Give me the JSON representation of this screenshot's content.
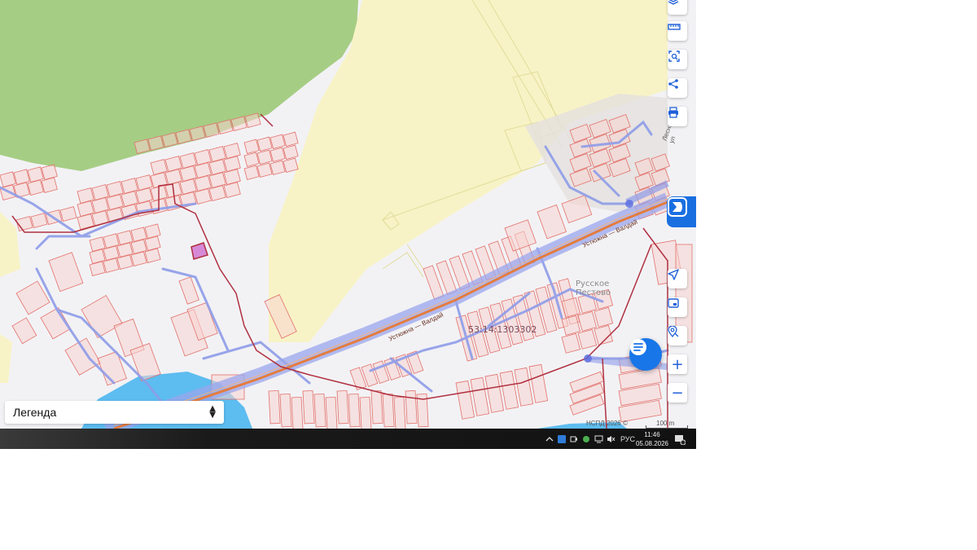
{
  "map": {
    "cadastral_number": "53:14:1303302",
    "locality": "Русское\nПестово",
    "locality_line1": "Русское",
    "locality_line2": "Пестово",
    "road_labels": [
      "Устюжна — Валдай",
      "Устюжна — Валдай",
      "Лесная ул"
    ],
    "attribution": "НСПД 2026 ©",
    "scale": "100 m",
    "colors": {
      "forest": "#a6cd84",
      "farmland": "#f8f3c6",
      "parcel_fill": "#f7d3d0",
      "parcel_stroke": "#e3716b",
      "road_blue": "#8e9ce8",
      "road_main": "#e47c3e",
      "boundary": "#b03040",
      "water": "#4cb6f0",
      "selected_parcel": "#d68ad6"
    }
  },
  "toolbar": {
    "top_buttons": [
      {
        "name": "layers-icon"
      },
      {
        "name": "ruler-icon"
      },
      {
        "name": "area-select-icon"
      },
      {
        "name": "share-icon"
      },
      {
        "name": "print-icon"
      }
    ],
    "bottom_buttons": [
      {
        "name": "navigate-icon"
      },
      {
        "name": "picture-in-picture-icon"
      },
      {
        "name": "location-search-icon"
      }
    ],
    "zoom_in": "+",
    "zoom_out": "−"
  },
  "legend": {
    "label": "Легенда"
  },
  "taskbar": {
    "language": "РУС",
    "time": "11:46",
    "date": "05.08.2026",
    "notification_count": "1"
  }
}
